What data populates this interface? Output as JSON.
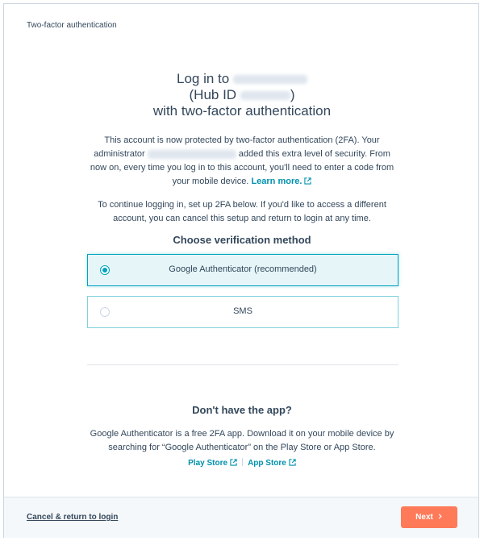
{
  "window": {
    "title": "Two-factor authentication"
  },
  "heading": {
    "line1_prefix": "Log in to",
    "line2_prefix": "(Hub ID",
    "line2_suffix": ")",
    "line3": "with two-factor authentication"
  },
  "intro": {
    "part1": "This account is now protected by two-factor authentication (2FA). Your administrator",
    "part2": "added this extra level of security. From now on, every time you log in to this account, you'll need to enter a code from your mobile device.",
    "learn_more": "Learn more."
  },
  "intro2": "To continue logging in, set up 2FA below. If you'd like to access a different account, you can cancel this setup and return to login at any time.",
  "verification": {
    "title": "Choose verification method",
    "options": [
      {
        "label": "Google Authenticator (recommended)",
        "selected": true
      },
      {
        "label": "SMS",
        "selected": false
      }
    ]
  },
  "app": {
    "title": "Don't have the app?",
    "description": "Google Authenticator is a free 2FA app. Download it on your mobile device by searching for “Google Authenticator” on the Play Store or App Store.",
    "play_store": "Play Store",
    "app_store": "App Store"
  },
  "footer": {
    "cancel": "Cancel & return to login",
    "next": "Next"
  },
  "icons": {
    "external_link": "external-link-icon",
    "chevron": "chevron-right-icon",
    "radio": "radio-icon"
  },
  "colors": {
    "accent": "#00a4bd",
    "link": "#0091ae",
    "primary_button": "#ff7a59",
    "text": "#33475b"
  }
}
